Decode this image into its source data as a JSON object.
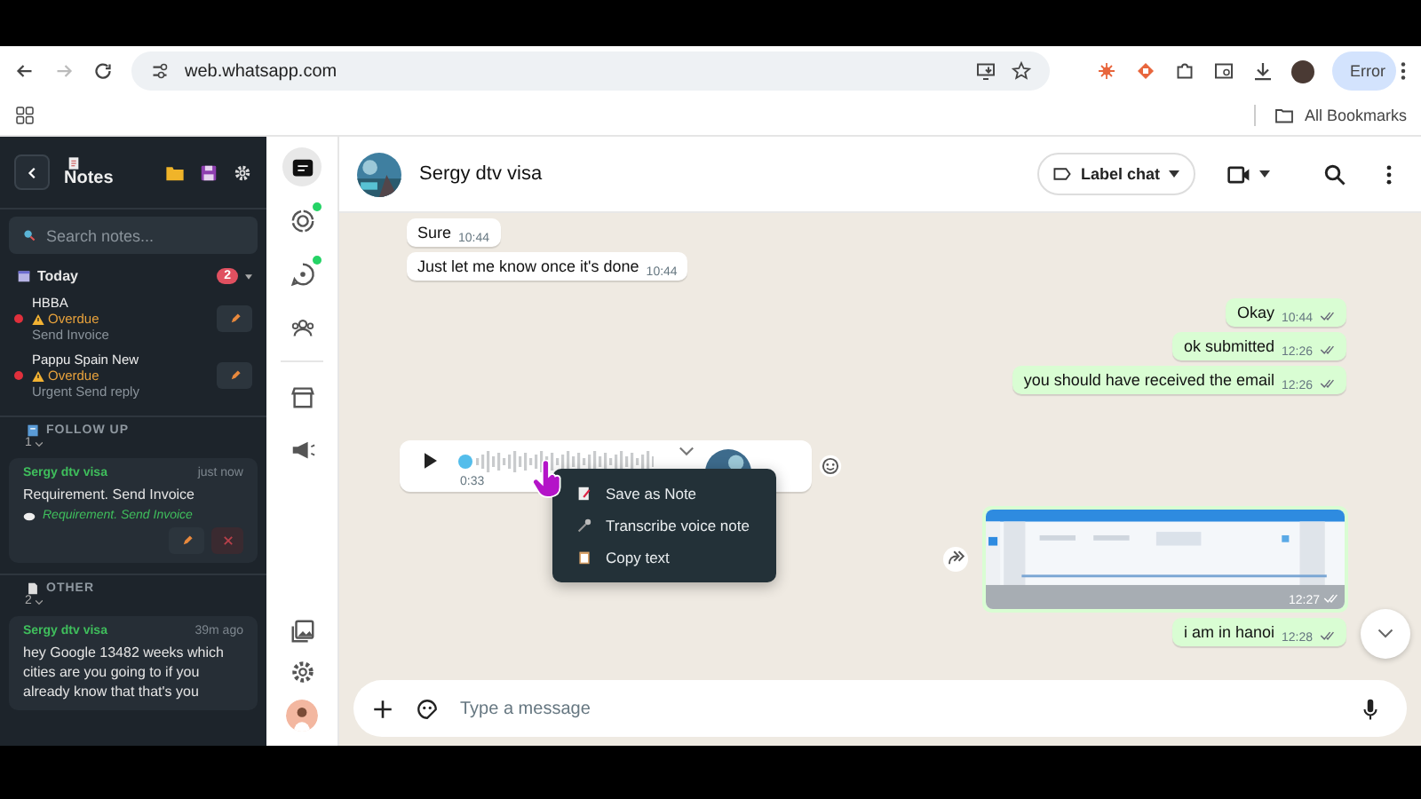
{
  "browser": {
    "url": "web.whatsapp.com",
    "profile_button": "Error",
    "bookmarks": "All Bookmarks"
  },
  "notes_panel": {
    "title": "Notes",
    "search": {
      "placeholder": "Search notes..."
    },
    "today": {
      "title": "Today",
      "count": "2",
      "expanded": true,
      "notes": [
        {
          "title": "HBBA",
          "status": "Overdue",
          "subtitle": "Send Invoice"
        },
        {
          "title": "Pappu Spain New",
          "status": "Overdue",
          "subtitle": "Urgent Send reply"
        }
      ]
    },
    "sections": [
      {
        "title": "FOLLOW UP",
        "count": "1",
        "kind": "followup",
        "cards": [
          {
            "contact": "Sergy dtv visa",
            "time": "just now",
            "text": "Requirement. Send Invoice",
            "quote": "Requirement. Send Invoice"
          }
        ]
      },
      {
        "title": "OTHER",
        "count": "2",
        "kind": "other",
        "cards": [
          {
            "contact": "Sergy dtv visa",
            "time": "39m ago",
            "text": "hey Google 13482 weeks which cities are you going to if you already know that that's you"
          }
        ]
      }
    ]
  },
  "rail": [
    {
      "kind": "chats",
      "selected": true,
      "dot": false
    },
    {
      "kind": "status",
      "selected": false,
      "dot": true
    },
    {
      "kind": "channels",
      "selected": false,
      "dot": true
    },
    {
      "kind": "communities",
      "selected": false,
      "dot": false
    },
    {
      "kind": "store",
      "selected": false,
      "dot": false
    },
    {
      "kind": "megaphone",
      "selected": false,
      "dot": false
    }
  ],
  "chat": {
    "contact": "Sergy dtv visa",
    "label_button": "Label chat",
    "messages": [
      {
        "kind": "in",
        "text": "Sure",
        "time": "10:44"
      },
      {
        "kind": "in",
        "text": "Just let me know once it's done",
        "time": "10:44"
      },
      {
        "kind": "out",
        "text": "Okay",
        "time": "10:44"
      },
      {
        "kind": "out",
        "text": "ok submitted",
        "time": "12:26"
      },
      {
        "kind": "out",
        "text": "you should have received the email",
        "time": "12:26"
      },
      {
        "kind": "voice",
        "duration": "0:33"
      },
      {
        "time": "12:27"
      },
      {
        "kind": "out",
        "text": "i am in hanoi",
        "time": "12:28"
      }
    ],
    "context_menu": [
      {
        "kind": "note",
        "label": "Save as Note"
      },
      {
        "kind": "mic",
        "label": "Transcribe voice note"
      },
      {
        "kind": "clipboard",
        "label": "Copy text"
      }
    ],
    "composer": {
      "placeholder": "Type a message"
    }
  }
}
